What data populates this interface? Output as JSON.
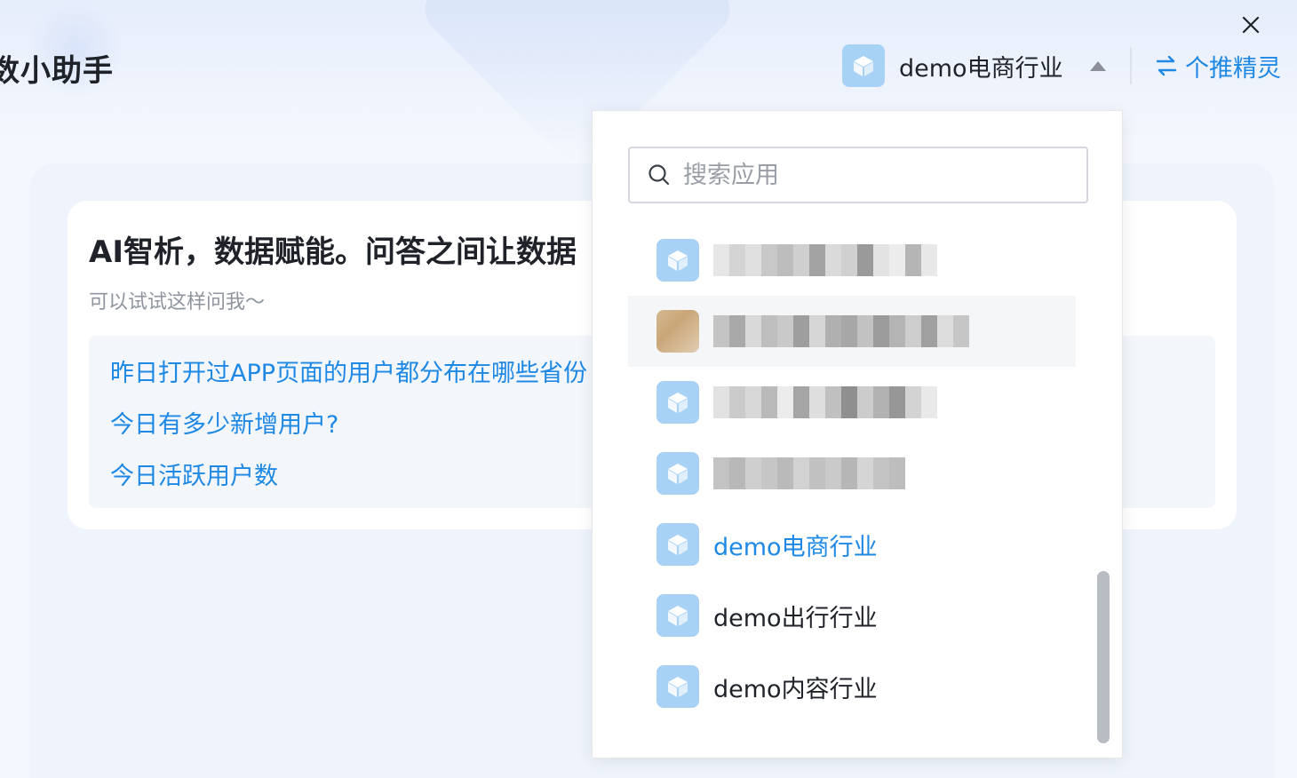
{
  "header": {
    "app_title": "数小助手",
    "close_icon": "close-icon",
    "current_app": "demo电商行业",
    "switch_label": "个推精灵",
    "switch_icon": "swap-arrows-icon"
  },
  "intro": {
    "title": "AI智析，数据赋能。问答之间让数据",
    "subtitle": "可以试试这样问我～",
    "suggestions": [
      "昨日打开过APP页面的用户都分布在哪些省份",
      "今日有多少新增用户?",
      "今日活跃用户数"
    ]
  },
  "dropdown": {
    "search_placeholder": "搜索应用",
    "items": [
      {
        "label": "",
        "blurred": true,
        "icon": "cube-icon"
      },
      {
        "label": "",
        "blurred": true,
        "icon": "photo-avatar",
        "hover": true
      },
      {
        "label": "",
        "blurred": true,
        "icon": "cube-icon"
      },
      {
        "label": "",
        "blurred": true,
        "icon": "cube-icon"
      },
      {
        "label": "demo电商行业",
        "blurred": false,
        "icon": "cube-icon",
        "selected": true
      },
      {
        "label": "demo出行行业",
        "blurred": false,
        "icon": "cube-icon"
      },
      {
        "label": "demo内容行业",
        "blurred": false,
        "icon": "cube-icon"
      }
    ]
  },
  "colors": {
    "accent": "#1e88e5",
    "app_icon_bg": "#a7d2f6",
    "text_primary": "#1f2329",
    "text_secondary": "#8f959e"
  }
}
